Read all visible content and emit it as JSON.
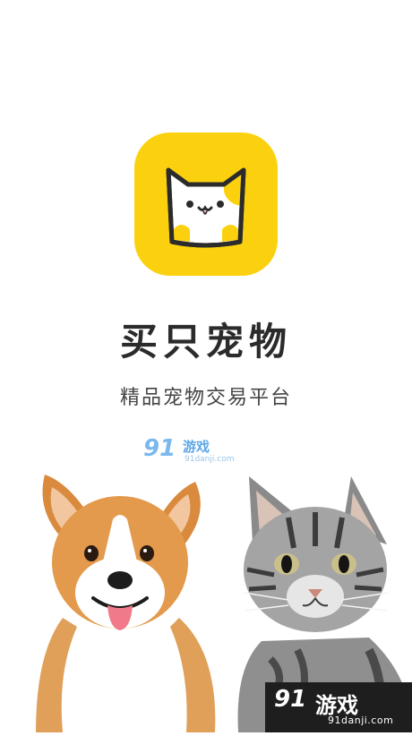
{
  "app": {
    "name": "买只宠物",
    "slogan": "精品宠物交易平台",
    "brand_color": "#FBD10F",
    "logo_icon": "cat-face-icon"
  },
  "watermark_top": {
    "mark": "91",
    "text": "游戏",
    "url": "91danji.com"
  },
  "watermark_bottom": {
    "mark": "91",
    "text": "游戏",
    "url": "91danji.com"
  },
  "images": {
    "left": "corgi-dog-photo",
    "right": "tabby-cat-photo"
  }
}
